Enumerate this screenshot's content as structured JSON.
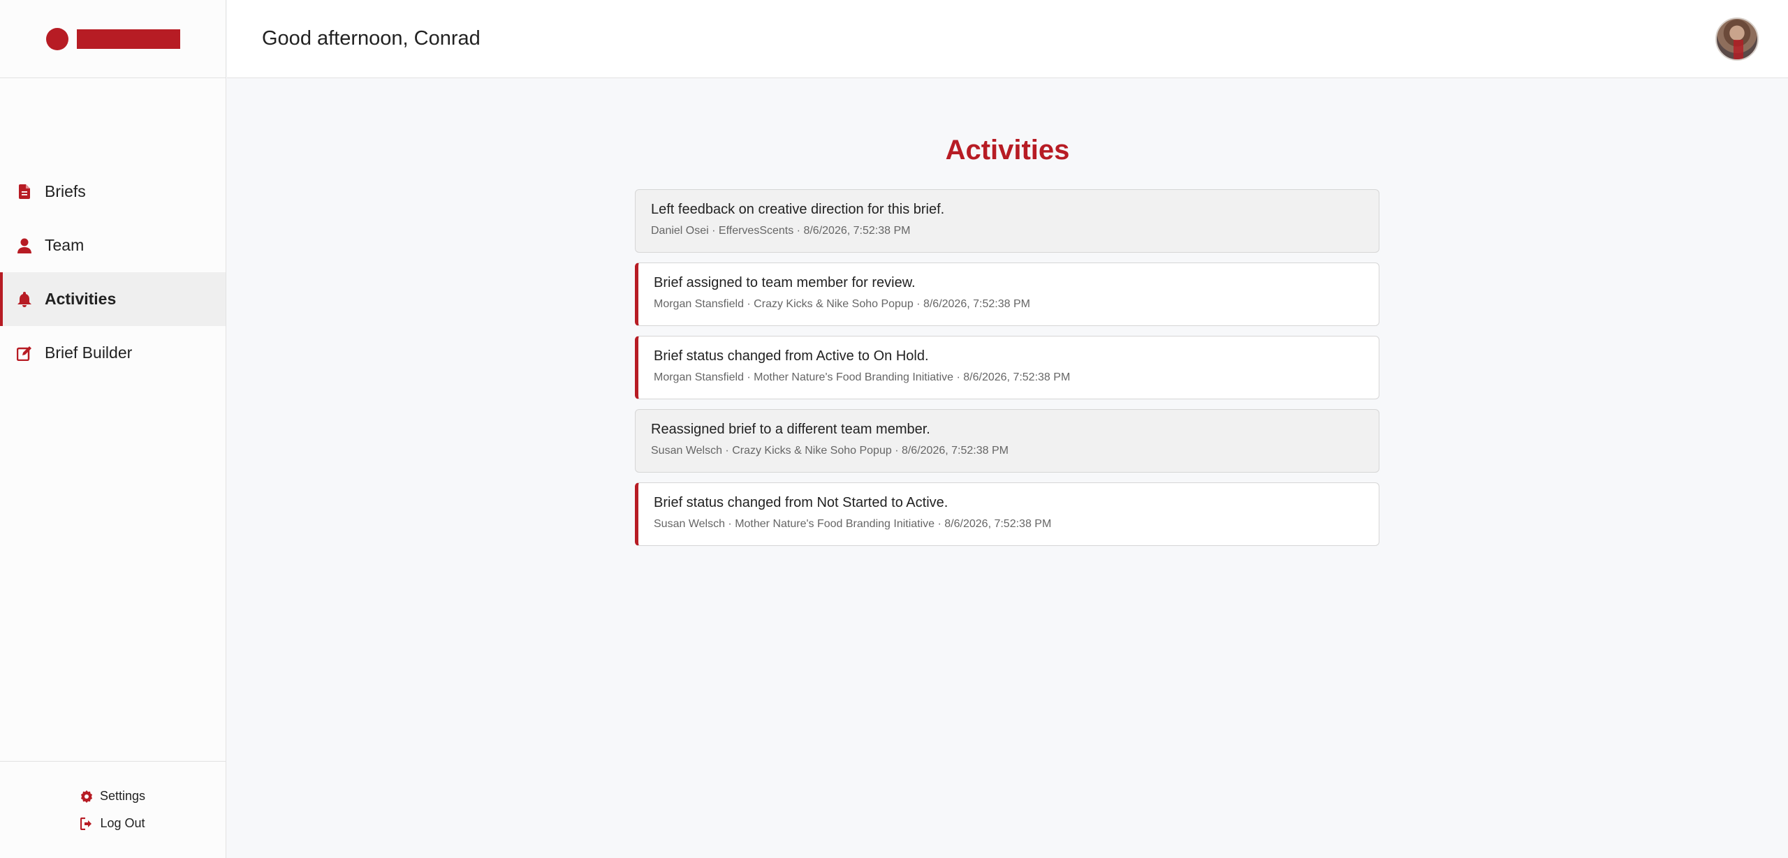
{
  "header": {
    "greeting": "Good afternoon, Conrad"
  },
  "sidebar": {
    "items": [
      {
        "label": "Briefs",
        "icon": "document-icon"
      },
      {
        "label": "Team",
        "icon": "user-icon"
      },
      {
        "label": "Activities",
        "icon": "bell-icon",
        "active": true
      },
      {
        "label": "Brief Builder",
        "icon": "edit-icon"
      }
    ],
    "footer": {
      "settings_label": "Settings",
      "logout_label": "Log Out"
    }
  },
  "main": {
    "title": "Activities",
    "activities": [
      {
        "title": "Left feedback on creative direction for this brief.",
        "meta": "Daniel Osei · EffervesScents · 8/6/2026, 7:52:38 PM",
        "status": "read"
      },
      {
        "title": "Brief assigned to team member for review.",
        "meta": "Morgan Stansfield · Crazy Kicks & Nike Soho Popup · 8/6/2026, 7:52:38 PM",
        "status": "unread"
      },
      {
        "title": "Brief status changed from Active to On Hold.",
        "meta": "Morgan Stansfield · Mother Nature's Food Branding Initiative · 8/6/2026, 7:52:38 PM",
        "status": "unread"
      },
      {
        "title": "Reassigned brief to a different team member.",
        "meta": "Susan Welsch · Crazy Kicks & Nike Soho Popup · 8/6/2026, 7:52:38 PM",
        "status": "read"
      },
      {
        "title": "Brief status changed from Not Started to Active.",
        "meta": "Susan Welsch · Mother Nature's Food Branding Initiative · 8/6/2026, 7:52:38 PM",
        "status": "unread"
      }
    ]
  },
  "colors": {
    "accent": "#b71c24",
    "background": "#f7f8fa"
  }
}
